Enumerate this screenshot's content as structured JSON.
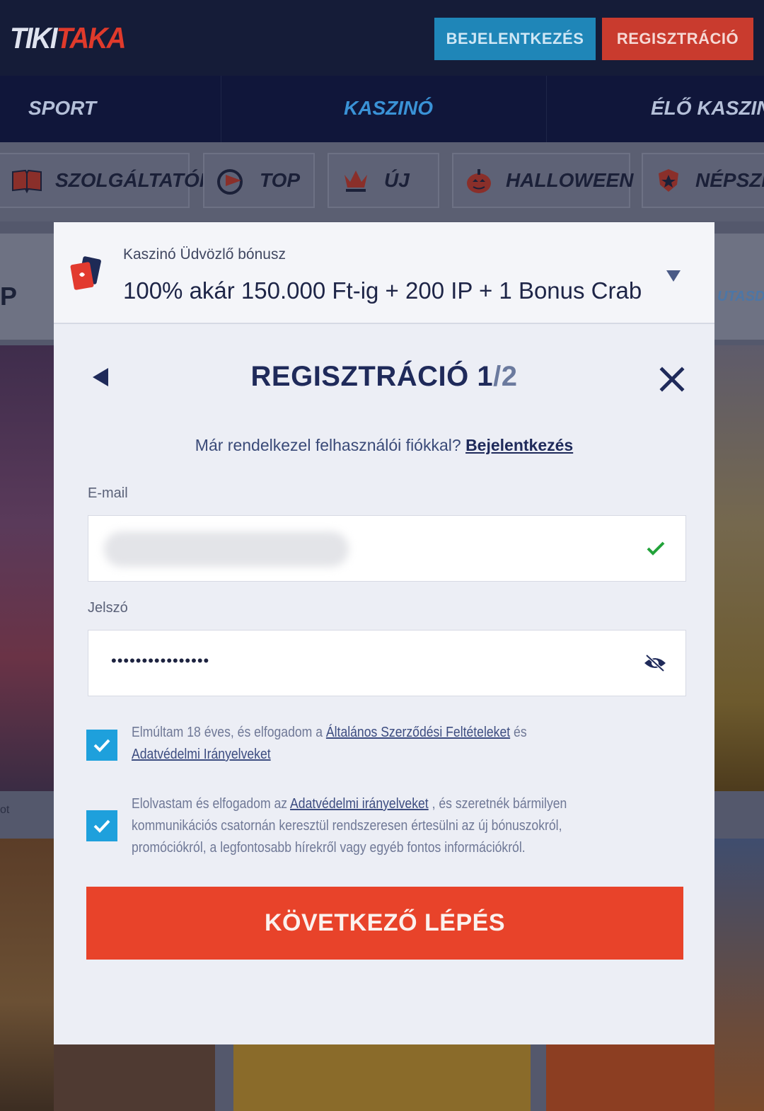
{
  "header": {
    "logo_part1": "TIKI",
    "logo_part2": "TAKA",
    "login_label": "BEJELENTKEZÉS",
    "register_label": "REGISZTRÁCIÓ"
  },
  "main_nav": {
    "items": [
      {
        "label": "SPORT"
      },
      {
        "label": "KASZINÓ",
        "active": true
      },
      {
        "label": "ÉLŐ KASZINÓ"
      }
    ]
  },
  "categories": [
    {
      "label": "SZOLGÁLTATÓK",
      "icon": "book-icon"
    },
    {
      "label": "TOP",
      "icon": "flag-icon"
    },
    {
      "label": "ÚJ",
      "icon": "crown-icon"
    },
    {
      "label": "HALLOWEEN",
      "icon": "pumpkin-icon"
    },
    {
      "label": "NÉPSZE",
      "icon": "star-badge-icon"
    }
  ],
  "background": {
    "left_text": "P",
    "right_text": "UTASD",
    "small_text": "ot"
  },
  "modal": {
    "bonus": {
      "subtitle": "Kaszinó Üdvözlő bónusz",
      "title": "100% akár 150.000 Ft-ig + 200 IP + 1 Bonus Crab",
      "icon": "playing-cards-icon"
    },
    "title_main": "REGISZTRÁCIÓ 1",
    "title_denom": "/2",
    "already_text": "Már rendelkezel felhasználói fiókkal?",
    "already_link": "Bejelentkezés",
    "email_label": "E-mail",
    "password_label": "Jelszó",
    "password_value": "••••••••••••••••",
    "consent1": {
      "text_before": "Elmúltam 18 éves, és elfogadom a ",
      "link1": "Általános Szerződési Feltételeket",
      "text_mid": " és",
      "link2": "Adatvédelmi Irányelveket",
      "checked": true
    },
    "consent2": {
      "text_before": "Elolvastam és elfogadom az ",
      "link": "Adatvédelmi irányelveket",
      "text_line1_after": " , és szeretnék bármilyen",
      "text_line2": "kommunikációs csatornán keresztül rendszeresen értesülni az új bónuszokról,",
      "text_line3": "promóciókról, a legfontosabb hírekről vagy egyéb fontos információkról.",
      "checked": true
    },
    "next_label": "KÖVETKEZŐ LÉPÉS"
  },
  "colors": {
    "accent_red": "#e8432a",
    "accent_blue": "#1ea0dc",
    "success_green": "#22a33a",
    "navy": "#1f2a5a"
  }
}
